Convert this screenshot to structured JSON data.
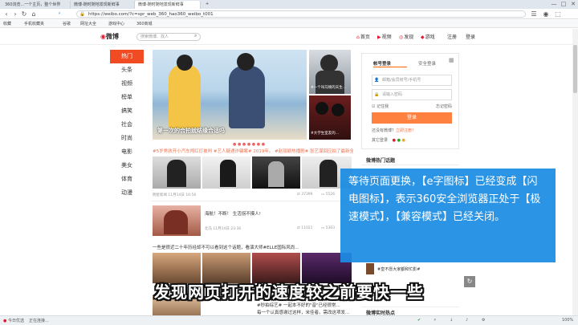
{
  "tabs": [
    {
      "label": "360浏览...一个主页，整个世界",
      "active": false
    },
    {
      "label": "微博-随时随地发现新鲜事",
      "active": false
    },
    {
      "label": "微博-随时随地发现新鲜事",
      "active": true
    }
  ],
  "window_controls": {
    "minimize": "—",
    "maximize": "□",
    "close": "✕"
  },
  "address_bar": {
    "url": "https://weibo.com/?c=spr_web_360_hao360_weibo_t001",
    "search_placeholder": "搜索"
  },
  "bookmarks": [
    "收藏",
    "手机收藏夹",
    "谷歌",
    "网址大全",
    "游戏中心",
    "360商城"
  ],
  "weibo_header": {
    "logo": "微博",
    "search_placeholder": "搜索微博、找人",
    "nav": [
      {
        "icon": "home-icon",
        "label": "首页"
      },
      {
        "icon": "video-icon",
        "label": "视频"
      },
      {
        "icon": "discover-icon",
        "label": "发现"
      },
      {
        "icon": "game-icon",
        "label": "游戏"
      },
      {
        "icon": "",
        "label": "注册"
      },
      {
        "icon": "",
        "label": "登录"
      }
    ]
  },
  "left_nav": [
    "热门",
    "头条",
    "视频",
    "榜单",
    "搞笑",
    "社会",
    "时尚",
    "电影",
    "美女",
    "体育",
    "动漫"
  ],
  "feed": {
    "hero_caption": "第一次的合拍就结缘合适吗",
    "side_card1": "#一个叫马顿的天生...",
    "side_card2": "#大学生室友的...",
    "ticker": "#5岁男孩开小汽车闯红灯被判 #艺人疑遇诈骗案# 2019年。 #赵丽颖热播剧# 张艺谋回应拍了最新全新的十年",
    "post1_meta": "明星新闻   11月14日 16:56",
    "post1_stats": {
      "reposts": "37399",
      "comments": "5526"
    },
    "post2_text": "海航！不断！ 生活拐不摸人!",
    "post2_meta": "北马   11月14日 23:36",
    "post2_stats": {
      "reposts": "11021",
      "comments": "5303"
    },
    "post3_text": "一些是很近二十年历经却不可以看到这个话题，看演大师#ELLE国际风尚...",
    "post4_text": "#秒拍综艺# 一起本不好的\"音\"已经很常...",
    "post4_text2": "每一个认真感谢过这样，米佳者。需改这项发..."
  },
  "login": {
    "tabs": [
      "帐号登录",
      "安全登录"
    ],
    "account_placeholder": "邮箱/会员帐号/手机号",
    "password_placeholder": "请输入密码",
    "remember": "记住我",
    "forgot": "忘记密码",
    "button": "登录",
    "no_account": "还没有微博？",
    "register": "立即注册！",
    "other_login": "其它登录"
  },
  "right_panel": {
    "recommend_title": "微博热门话题",
    "topic": "#皇不愿大家都和忙影#",
    "hot_title": "微博实时热点"
  },
  "callout": "等待页面更换，【e字图标】已经变成【闪电图标】，表示360安全浏览器正处于【极速模式】，【兼容模式】已经关闭。",
  "subtitle": "发现网页打开的速度较之前要快一些",
  "statusbar": {
    "left1": "今日优选",
    "left2": "正在连接...",
    "zoom": "100%"
  }
}
